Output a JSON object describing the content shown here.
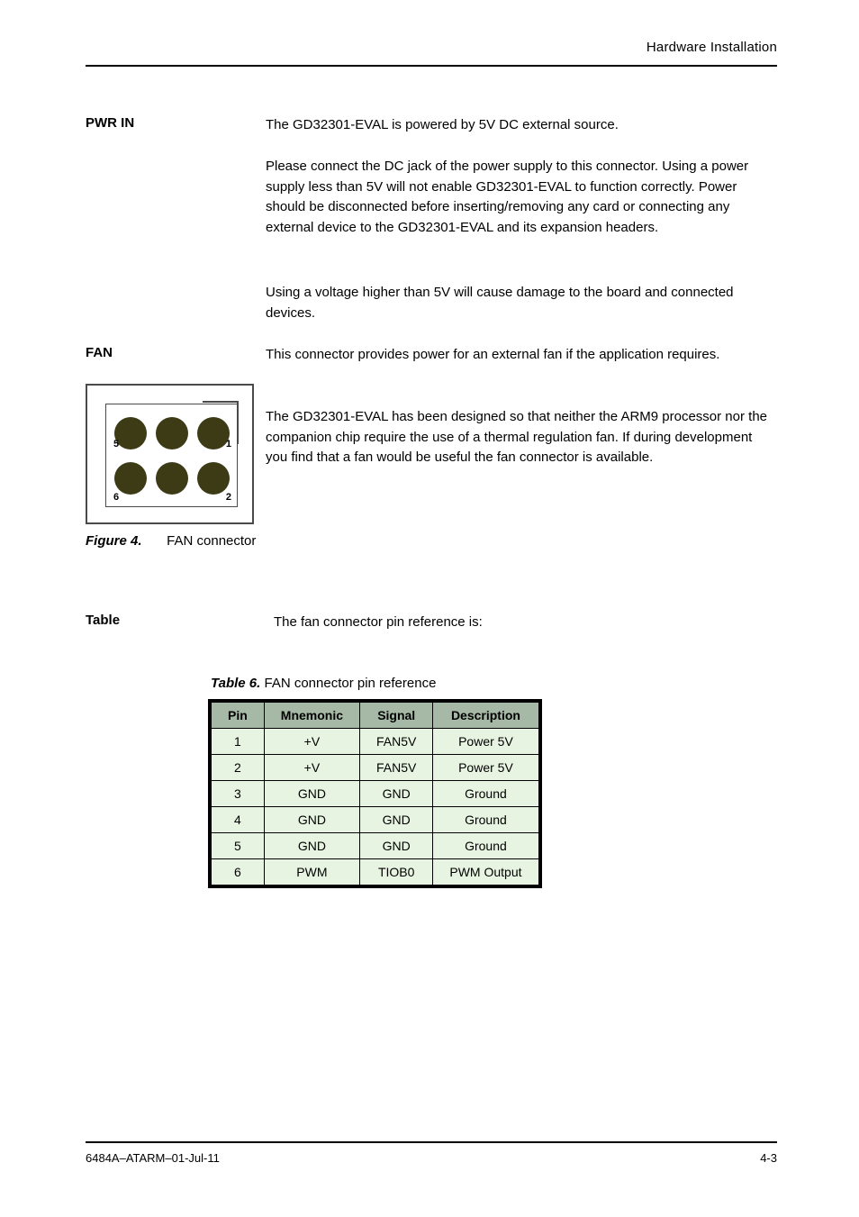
{
  "header": {
    "title": "Hardware Installation"
  },
  "margins": {
    "pwr_in": "PWR IN",
    "fan": "FAN",
    "table_tag": "Table"
  },
  "paragraphs": {
    "p1": "The GD32301-EVAL is powered by 5V DC external source.",
    "p2": "Please connect the DC jack of the power supply to this connector. Using a power supply less than 5V will not enable GD32301-EVAL to function correctly. Power should be disconnected before inserting/removing any card or connecting any external device to the GD32301-EVAL and its expansion headers.",
    "p3": "Using a voltage higher than 5V will cause damage to the board and connected devices.",
    "p4": "This connector provides power for an external fan if the application requires."
  },
  "figure": {
    "caption_label": "Figure 4.",
    "caption_text": "FAN connector",
    "side_text": "The GD32301-EVAL has been designed so that neither the ARM9 processor nor the companion chip require the use of a thermal regulation fan. If during development you find that a fan would be useful the fan connector is available."
  },
  "table": {
    "caption_label": "Table 6.",
    "caption_text": "FAN connector pin reference",
    "headers": [
      "Pin",
      "Mnemonic",
      "Signal",
      "Description"
    ],
    "rows": [
      [
        "1",
        "+V",
        "FAN5V",
        "Power 5V"
      ],
      [
        "2",
        "+V",
        "FAN5V",
        "Power 5V"
      ],
      [
        "3",
        "GND",
        "GND",
        "Ground"
      ],
      [
        "4",
        "GND",
        "GND",
        "Ground"
      ],
      [
        "5",
        "GND",
        "GND",
        "Ground"
      ],
      [
        "6",
        "PWM",
        "TIOB0",
        "PWM Output"
      ]
    ],
    "pin_labels": {
      "tl": "5",
      "tr": "1",
      "bl": "6",
      "br": "2"
    }
  },
  "lower_note": "The fan connector pin reference is:",
  "footer": {
    "left": "6484A–ATARM–01-Jul-11",
    "right": "4-3"
  }
}
